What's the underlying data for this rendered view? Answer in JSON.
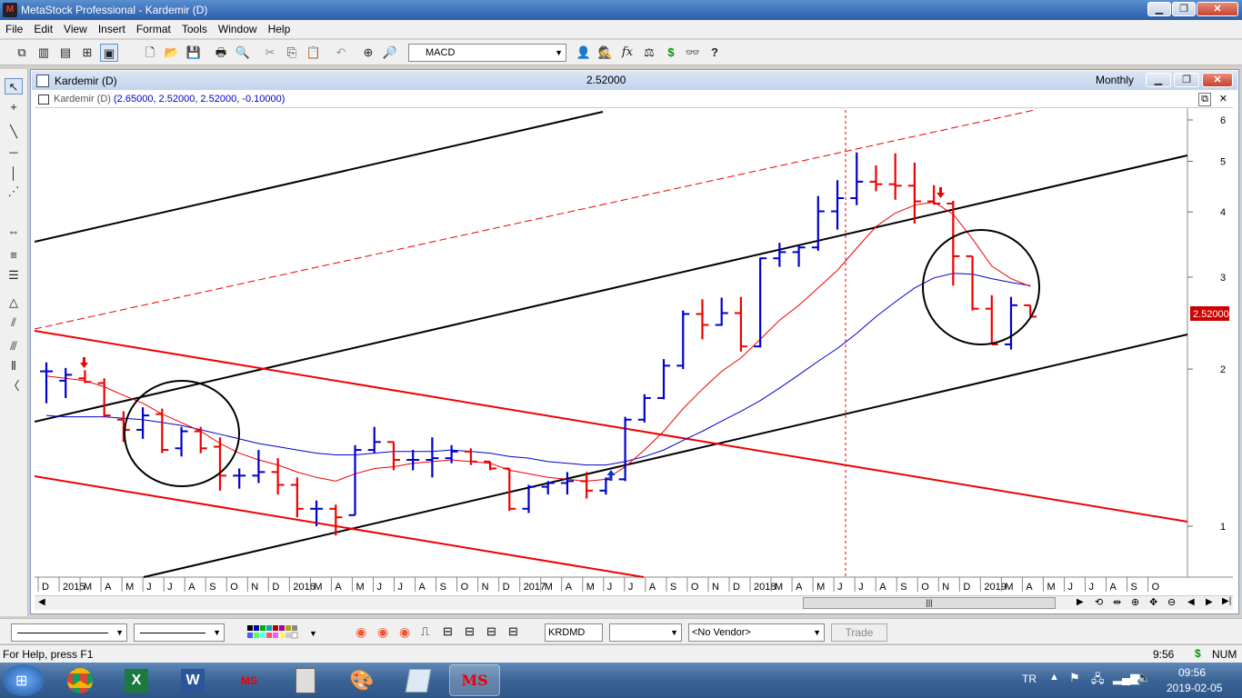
{
  "window": {
    "title": "MetaStock Professional - Kardemir (D)",
    "minimize": "▁",
    "restore": "❐",
    "close": "✕"
  },
  "menu": [
    "File",
    "Edit",
    "View",
    "Insert",
    "Format",
    "Tools",
    "Window",
    "Help"
  ],
  "toolbar": {
    "indicator_select": "MACD"
  },
  "chart_window": {
    "title": "Kardemir (D)",
    "last_price": "2.52000",
    "periodicity": "Monthly",
    "header_name": "Kardemir (D)",
    "header_values": "(2.65000, 2.52000, 2.52000, -0.10000)",
    "price_flag": "2.52000"
  },
  "bottom": {
    "symbol": "KRDMD",
    "vendor": "<No Vendor>",
    "trade_button": "Trade"
  },
  "status": {
    "help": "For Help, press F1",
    "time": "9:56",
    "currency": "$",
    "num": "NUM"
  },
  "taskbar": {
    "lang": "TR",
    "clock_time": "09:56",
    "clock_date": "2019-02-05",
    "ms_label": "MS"
  },
  "colors": {
    "up_bar": "#0000cc",
    "down_bar": "#ee0000",
    "ma_fast": "#ee0000",
    "ma_slow": "#0000cc",
    "channel_black": "#000000",
    "channel_red": "#ee0000"
  },
  "chart_data": {
    "type": "ohlc",
    "y_scale": "log",
    "y_ticks": [
      1,
      2,
      3,
      4,
      5,
      6
    ],
    "x_ticks": [
      "D",
      "2015",
      "M",
      "A",
      "M",
      "J",
      "J",
      "A",
      "S",
      "O",
      "N",
      "D",
      "2016",
      "M",
      "A",
      "M",
      "J",
      "J",
      "A",
      "S",
      "O",
      "N",
      "D",
      "2017",
      "M",
      "A",
      "M",
      "J",
      "J",
      "A",
      "S",
      "O",
      "N",
      "D",
      "2018",
      "M",
      "A",
      "M",
      "J",
      "J",
      "A",
      "S",
      "O",
      "N",
      "D",
      "2019",
      "M",
      "A",
      "M",
      "J",
      "J",
      "A",
      "S",
      "O"
    ],
    "bars": [
      {
        "o": 1.98,
        "h": 2.06,
        "l": 1.72,
        "c": 1.98
      },
      {
        "o": 1.9,
        "h": 2.01,
        "l": 1.76,
        "c": 1.95
      },
      {
        "o": 1.92,
        "h": 1.99,
        "l": 1.88,
        "c": 1.89
      },
      {
        "o": 1.88,
        "h": 1.92,
        "l": 1.62,
        "c": 1.63
      },
      {
        "o": 1.6,
        "h": 1.66,
        "l": 1.45,
        "c": 1.53
      },
      {
        "o": 1.53,
        "h": 1.69,
        "l": 1.47,
        "c": 1.63
      },
      {
        "o": 1.64,
        "h": 1.68,
        "l": 1.38,
        "c": 1.4
      },
      {
        "o": 1.41,
        "h": 1.55,
        "l": 1.36,
        "c": 1.52
      },
      {
        "o": 1.52,
        "h": 1.55,
        "l": 1.38,
        "c": 1.41
      },
      {
        "o": 1.42,
        "h": 1.48,
        "l": 1.17,
        "c": 1.25
      },
      {
        "o": 1.25,
        "h": 1.29,
        "l": 1.18,
        "c": 1.25
      },
      {
        "o": 1.25,
        "h": 1.4,
        "l": 1.21,
        "c": 1.27
      },
      {
        "o": 1.27,
        "h": 1.35,
        "l": 1.15,
        "c": 1.2
      },
      {
        "o": 1.2,
        "h": 1.24,
        "l": 1.04,
        "c": 1.08
      },
      {
        "o": 1.08,
        "h": 1.12,
        "l": 1.0,
        "c": 1.08
      },
      {
        "o": 1.08,
        "h": 1.1,
        "l": 0.96,
        "c": 1.04
      },
      {
        "o": 1.05,
        "h": 1.43,
        "l": 1.05,
        "c": 1.4
      },
      {
        "o": 1.4,
        "h": 1.55,
        "l": 1.38,
        "c": 1.45
      },
      {
        "o": 1.45,
        "h": 1.45,
        "l": 1.28,
        "c": 1.34
      },
      {
        "o": 1.34,
        "h": 1.4,
        "l": 1.28,
        "c": 1.34
      },
      {
        "o": 1.34,
        "h": 1.48,
        "l": 1.24,
        "c": 1.35
      },
      {
        "o": 1.35,
        "h": 1.43,
        "l": 1.32,
        "c": 1.39
      },
      {
        "o": 1.39,
        "h": 1.41,
        "l": 1.31,
        "c": 1.33
      },
      {
        "o": 1.33,
        "h": 1.33,
        "l": 1.28,
        "c": 1.29
      },
      {
        "o": 1.29,
        "h": 1.29,
        "l": 1.07,
        "c": 1.08
      },
      {
        "o": 1.08,
        "h": 1.2,
        "l": 1.06,
        "c": 1.19
      },
      {
        "o": 1.19,
        "h": 1.22,
        "l": 1.15,
        "c": 1.21
      },
      {
        "o": 1.21,
        "h": 1.27,
        "l": 1.15,
        "c": 1.22
      },
      {
        "o": 1.22,
        "h": 1.27,
        "l": 1.13,
        "c": 1.17
      },
      {
        "o": 1.17,
        "h": 1.24,
        "l": 1.15,
        "c": 1.23
      },
      {
        "o": 1.23,
        "h": 1.62,
        "l": 1.22,
        "c": 1.6
      },
      {
        "o": 1.6,
        "h": 1.79,
        "l": 1.58,
        "c": 1.76
      },
      {
        "o": 1.76,
        "h": 2.09,
        "l": 1.75,
        "c": 2.03
      },
      {
        "o": 2.03,
        "h": 2.59,
        "l": 2.0,
        "c": 2.55
      },
      {
        "o": 2.55,
        "h": 2.72,
        "l": 2.28,
        "c": 2.43
      },
      {
        "o": 2.43,
        "h": 2.74,
        "l": 2.42,
        "c": 2.56
      },
      {
        "o": 2.56,
        "h": 2.75,
        "l": 2.16,
        "c": 2.21
      },
      {
        "o": 2.21,
        "h": 3.27,
        "l": 2.2,
        "c": 3.26
      },
      {
        "o": 3.26,
        "h": 3.49,
        "l": 3.14,
        "c": 3.35
      },
      {
        "o": 3.35,
        "h": 3.45,
        "l": 3.14,
        "c": 3.42
      },
      {
        "o": 3.42,
        "h": 4.29,
        "l": 3.37,
        "c": 4.01
      },
      {
        "o": 4.01,
        "h": 4.6,
        "l": 3.7,
        "c": 4.25
      },
      {
        "o": 4.25,
        "h": 5.2,
        "l": 4.12,
        "c": 4.57
      },
      {
        "o": 4.57,
        "h": 4.91,
        "l": 4.38,
        "c": 4.52
      },
      {
        "o": 4.52,
        "h": 5.18,
        "l": 4.22,
        "c": 4.49
      },
      {
        "o": 4.49,
        "h": 4.97,
        "l": 3.8,
        "c": 4.19
      },
      {
        "o": 4.19,
        "h": 4.5,
        "l": 4.13,
        "c": 4.15
      },
      {
        "o": 4.15,
        "h": 4.2,
        "l": 2.89,
        "c": 3.29
      },
      {
        "o": 3.29,
        "h": 3.29,
        "l": 2.59,
        "c": 2.61
      },
      {
        "o": 2.61,
        "h": 2.77,
        "l": 2.23,
        "c": 2.23
      },
      {
        "o": 2.23,
        "h": 2.75,
        "l": 2.18,
        "c": 2.65
      },
      {
        "o": 2.65,
        "h": 2.65,
        "l": 2.52,
        "c": 2.52
      }
    ],
    "ma_fast": [
      1.94,
      1.92,
      1.9,
      1.85,
      1.78,
      1.72,
      1.64,
      1.58,
      1.52,
      1.44,
      1.38,
      1.34,
      1.31,
      1.27,
      1.24,
      1.22,
      1.26,
      1.29,
      1.3,
      1.32,
      1.33,
      1.34,
      1.33,
      1.32,
      1.28,
      1.26,
      1.24,
      1.23,
      1.22,
      1.23,
      1.3,
      1.4,
      1.52,
      1.68,
      1.83,
      1.98,
      2.1,
      2.28,
      2.48,
      2.65,
      2.86,
      3.09,
      3.41,
      3.75,
      3.98,
      4.12,
      4.18,
      3.96,
      3.55,
      3.15,
      2.98,
      2.88
    ],
    "ma_slow": [
      1.63,
      1.62,
      1.62,
      1.62,
      1.61,
      1.6,
      1.58,
      1.56,
      1.53,
      1.5,
      1.47,
      1.44,
      1.42,
      1.4,
      1.38,
      1.37,
      1.37,
      1.38,
      1.39,
      1.39,
      1.39,
      1.4,
      1.39,
      1.38,
      1.36,
      1.35,
      1.33,
      1.32,
      1.31,
      1.31,
      1.33,
      1.36,
      1.4,
      1.46,
      1.52,
      1.59,
      1.66,
      1.74,
      1.84,
      1.95,
      2.07,
      2.19,
      2.34,
      2.52,
      2.69,
      2.86,
      2.99,
      3.05,
      3.04,
      2.98,
      2.93,
      2.89
    ]
  }
}
